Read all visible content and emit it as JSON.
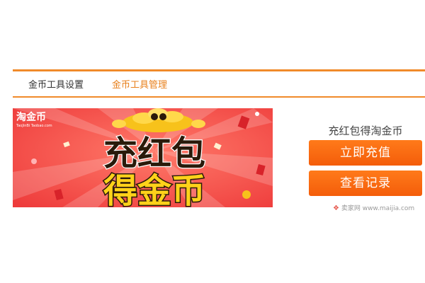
{
  "tabs": [
    {
      "label": "金币工具设置",
      "active": false
    },
    {
      "label": "金币工具管理",
      "active": true
    }
  ],
  "banner": {
    "logo_text": "淘金币",
    "logo_subtext": "TaoJinBi Taobao.com",
    "headline_line1": "充红包",
    "headline_line2": "得金币",
    "colors": {
      "background": "#f25050",
      "line1": "#2a1a0a",
      "line2": "#ffd21a"
    }
  },
  "promo": {
    "text": "充红包得淘金币",
    "recharge_button": "立即充值",
    "records_button": "查看记录"
  },
  "watermark": {
    "text": "卖家网 www.maijia.com"
  },
  "colors": {
    "accent": "#f08a2a",
    "button": "#f45d0a",
    "active_tab": "#e8801c"
  }
}
